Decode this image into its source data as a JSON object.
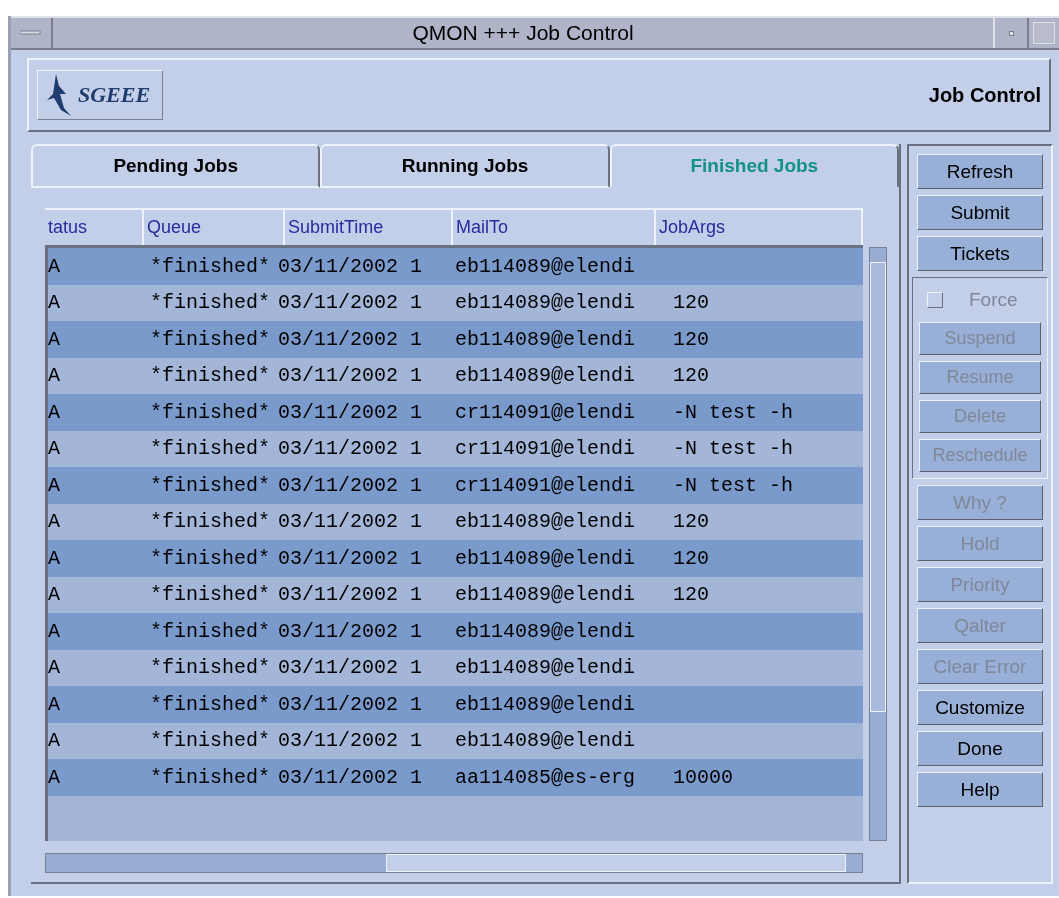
{
  "window": {
    "title": "QMON +++ Job Control"
  },
  "header": {
    "logo_text": "SGEEE",
    "title": "Job Control"
  },
  "tabs": [
    {
      "label": "Pending Jobs",
      "selected": false
    },
    {
      "label": "Running Jobs",
      "selected": false
    },
    {
      "label": "Finished Jobs",
      "selected": true
    }
  ],
  "table": {
    "columns": [
      "tatus",
      "Queue",
      "SubmitTime",
      "MailTo",
      "JobArgs"
    ],
    "rows": [
      {
        "status": "A",
        "queue": "*finished*",
        "submit_time": "03/11/2002 1",
        "mail_to": "eb114089@elendi"
      },
      {
        "status": "A",
        "queue": "*finished*",
        "submit_time": "03/11/2002 1",
        "mail_to": "eb114089@elendi",
        "job_args": "120"
      },
      {
        "status": "A",
        "queue": "*finished*",
        "submit_time": "03/11/2002 1",
        "mail_to": "eb114089@elendi",
        "job_args": "120"
      },
      {
        "status": "A",
        "queue": "*finished*",
        "submit_time": "03/11/2002 1",
        "mail_to": "eb114089@elendi",
        "job_args": "120"
      },
      {
        "status": "A",
        "queue": "*finished*",
        "submit_time": "03/11/2002 1",
        "mail_to": "cr114091@elendi",
        "job_args": "-N test -h"
      },
      {
        "status": "A",
        "queue": "*finished*",
        "submit_time": "03/11/2002 1",
        "mail_to": "cr114091@elendi",
        "job_args": "-N test -h"
      },
      {
        "status": "A",
        "queue": "*finished*",
        "submit_time": "03/11/2002 1",
        "mail_to": "cr114091@elendi",
        "job_args": "-N test -h"
      },
      {
        "status": "A",
        "queue": "*finished*",
        "submit_time": "03/11/2002 1",
        "mail_to": "eb114089@elendi",
        "job_args": "120"
      },
      {
        "status": "A",
        "queue": "*finished*",
        "submit_time": "03/11/2002 1",
        "mail_to": "eb114089@elendi",
        "job_args": "120"
      },
      {
        "status": "A",
        "queue": "*finished*",
        "submit_time": "03/11/2002 1",
        "mail_to": "eb114089@elendi",
        "job_args": "120"
      },
      {
        "status": "A",
        "queue": "*finished*",
        "submit_time": "03/11/2002 1",
        "mail_to": "eb114089@elendi"
      },
      {
        "status": "A",
        "queue": "*finished*",
        "submit_time": "03/11/2002 1",
        "mail_to": "eb114089@elendi"
      },
      {
        "status": "A",
        "queue": "*finished*",
        "submit_time": "03/11/2002 1",
        "mail_to": "eb114089@elendi"
      },
      {
        "status": "A",
        "queue": "*finished*",
        "submit_time": "03/11/2002 1",
        "mail_to": "eb114089@elendi"
      },
      {
        "status": "A",
        "queue": "*finished*",
        "submit_time": "03/11/2002 1",
        "mail_to": "aa114085@es-erg",
        "job_args": "10000"
      }
    ]
  },
  "sidebar": {
    "items": [
      {
        "kind": "button",
        "label": "Refresh",
        "disabled": false
      },
      {
        "kind": "button",
        "label": "Submit",
        "disabled": false
      },
      {
        "kind": "button",
        "label": "Tickets",
        "disabled": false
      },
      {
        "kind": "group",
        "children": [
          {
            "kind": "checkbox",
            "label": "Force",
            "checked": false,
            "disabled": true
          },
          {
            "kind": "button",
            "label": "Suspend",
            "disabled": true
          },
          {
            "kind": "button",
            "label": "Resume",
            "disabled": true
          },
          {
            "kind": "button",
            "label": "Delete",
            "disabled": true
          },
          {
            "kind": "button",
            "label": "Reschedule",
            "disabled": true
          }
        ]
      },
      {
        "kind": "button",
        "label": "Why ?",
        "disabled": true
      },
      {
        "kind": "button",
        "label": "Hold",
        "disabled": true
      },
      {
        "kind": "button",
        "label": "Priority",
        "disabled": true
      },
      {
        "kind": "button",
        "label": "Qalter",
        "disabled": true
      },
      {
        "kind": "button",
        "label": "Clear Error",
        "disabled": true
      },
      {
        "kind": "button",
        "label": "Customize",
        "disabled": false
      },
      {
        "kind": "button",
        "label": "Done",
        "disabled": false
      },
      {
        "kind": "button",
        "label": "Help",
        "disabled": false
      }
    ]
  }
}
